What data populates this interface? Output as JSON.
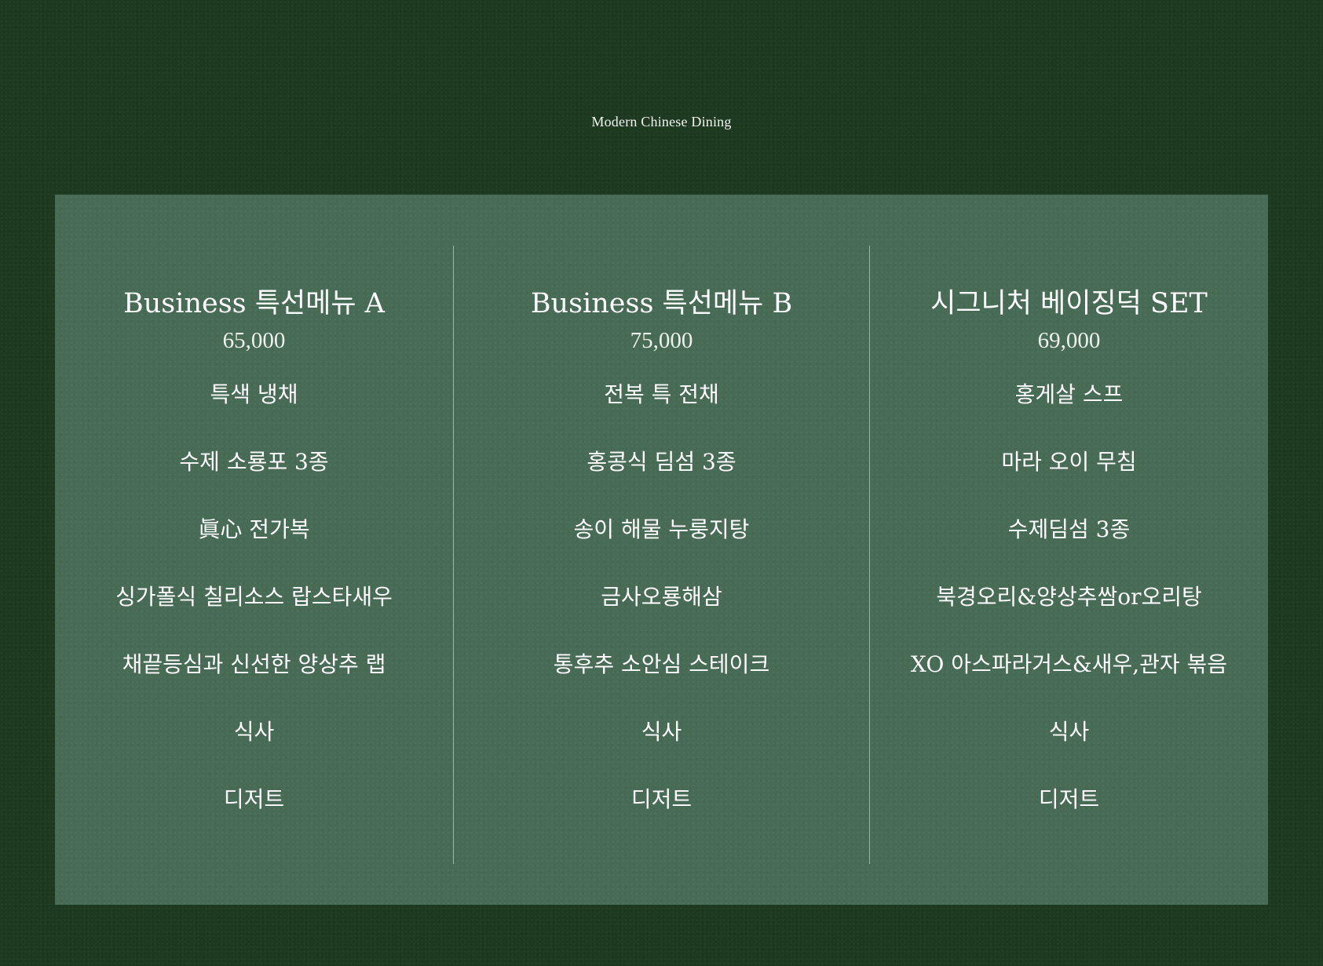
{
  "header": {
    "subtitle": "Modern Chinese Dining"
  },
  "menus": [
    {
      "title": "Business 특선메뉴 A",
      "price": "65,000",
      "items": [
        "특색 냉채",
        "수제 소룡포 3종",
        "眞心 전가복",
        "싱가폴식 칠리소스 랍스타새우",
        "채끝등심과 신선한 양상추 랩",
        "식사",
        "디저트"
      ]
    },
    {
      "title": "Business 특선메뉴 B",
      "price": "75,000",
      "items": [
        "전복 특 전채",
        "홍콩식 딤섬 3종",
        "송이 해물 누룽지탕",
        "금사오룡해삼",
        "통후추 소안심 스테이크",
        "식사",
        "디저트"
      ]
    },
    {
      "title": "시그니처 베이징덕 SET",
      "price": "69,000",
      "items": [
        "홍게살 스프",
        "마라 오이 무침",
        "수제딤섬 3종",
        "북경오리&양상추쌈or오리탕",
        "XO 아스파라거스&새우,관자 볶음",
        "식사",
        "디저트"
      ]
    }
  ],
  "colors": {
    "background": "#1d3a20",
    "panel": "#476b55",
    "text": "#ffffff"
  }
}
